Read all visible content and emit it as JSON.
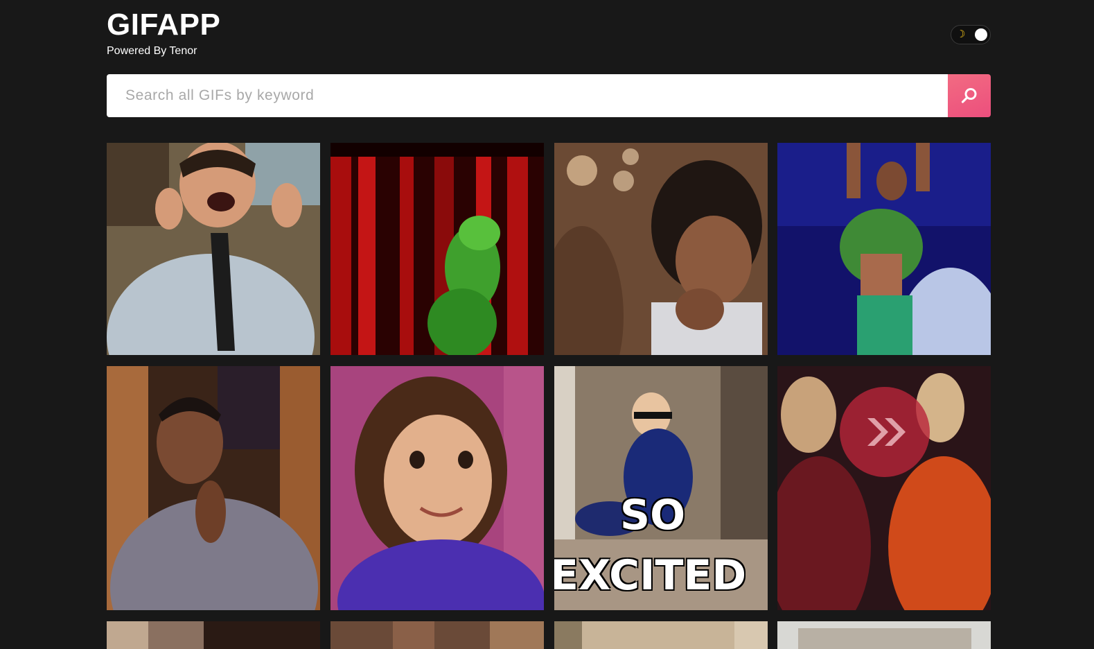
{
  "app": {
    "title": "GIFAPP",
    "subtitle": "Powered By Tenor"
  },
  "theme_toggle": {
    "icon": "moon-icon",
    "state": "dark"
  },
  "search": {
    "placeholder": "Search all GIFs by keyword",
    "value": "",
    "button_icon": "search-icon"
  },
  "colors": {
    "background": "#181818",
    "accent_start": "#f26b82",
    "accent_end": "#ec4f7d"
  },
  "gifs": {
    "row1": [
      "laughing-man-gif",
      "dancing-frog-puppet-gif",
      "excited-girl-gif",
      "cheering-boy-gif"
    ],
    "row2": [
      "clapping-man-gif",
      "smiling-girl-gif",
      "so-excited-toddler-gif",
      "cheering-women-gif"
    ],
    "row3": [
      "gif-9",
      "gif-10",
      "gif-11",
      "gif-12"
    ],
    "caption_so": "SO",
    "caption_excited": "EXCITED"
  }
}
